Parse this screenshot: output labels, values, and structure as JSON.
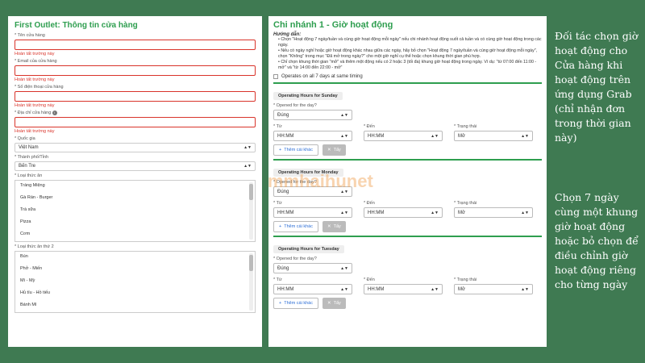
{
  "left": {
    "title": "First Outlet: Thông tin cửa hàng",
    "fields": [
      {
        "label": "* Tên cửa hàng",
        "error": "Hoàn tất trường này"
      },
      {
        "label": "* Email của cửa hàng",
        "error": "Hoàn tất trường này"
      },
      {
        "label": "* Số điện thoại cửa hàng",
        "error": "Hoàn tất trường này"
      },
      {
        "label": "* Địa chỉ cửa hàng",
        "error": "Hoàn tất trường này"
      }
    ],
    "country": {
      "label": "* Quốc gia",
      "value": "Việt Nam"
    },
    "city": {
      "label": "* Thành phố/Tỉnh",
      "value": "Bến Tre"
    },
    "food1": {
      "label": "* Loại thức ăn",
      "items": [
        "Tráng Miệng",
        "Gà Rán - Burger",
        "Trà sữa",
        "Pizza",
        "Cơm"
      ]
    },
    "food2": {
      "label": "* Loại thức ăn thứ 2",
      "items": [
        "Bún",
        "Phở - Miến",
        "Mì - Mỳ",
        "Hủ tíu - Hồ tiếu",
        "Bánh Mì"
      ]
    }
  },
  "right": {
    "title": "Chi nhánh 1 - Giờ hoạt động",
    "guide_heading": "Hướng dẫn:",
    "guide": [
      "Chọn \"Hoạt động 7 ngày/tuần và cùng giờ hoạt động mỗi ngày\" nếu chi nhánh hoạt động suốt cả tuần và có cùng giờ hoạt động trong các ngày.",
      "Nếu có ngày nghỉ hoặc giờ hoạt động khác nhau giữa các ngày, hãy bỏ chọn \"Hoạt động 7 ngày/tuần và cùng giờ hoạt động mỗi ngày\", chọn \"Không\" trong mục \"Đã mở trong ngày?\" cho một giờ nghỉ cụ thể hoặc chọn khung thời gian phù hợp.",
      "Chỉ chọn khung thời gian \"mở\" và thêm một động nếu có 2 hoặc 3 (tối đa) khung giờ hoạt động trong ngày. Ví dụ: \"từ 07:00 đến 11:00 - mở\" và \"từ 14:00 đến 22:00 - mở\""
    ],
    "checkbox_label": "Operates on all 7 days at same timing",
    "days": [
      {
        "header": "Operating Hours for Sunday"
      },
      {
        "header": "Operating Hours for Monday"
      },
      {
        "header": "Operating Hours for Tuesday"
      }
    ],
    "opened_label": "* Opened for the day?",
    "opened_value": "Đúng",
    "from_label": "* Từ",
    "to_label": "* Đến",
    "status_label": "* Trạng thái",
    "time_placeholder": "HH:MM",
    "status_value": "Mở",
    "add_label": "Thêm cái khác",
    "del_label": "Tẩy"
  },
  "watermark": "mmhaihunet",
  "caption": {
    "p1": "Đối tác chọn giờ hoạt động cho Cửa hàng khi hoạt động trên ứng dụng Grab (chỉ nhận đơn trong thời gian này)",
    "p2": "Chọn 7 ngày cùng một khung giờ hoạt động hoặc bỏ chọn để điều chỉnh giờ hoạt động riêng cho từng ngày"
  },
  "colors": {
    "background": "#3f7a52",
    "accent": "#2e9e4f",
    "error": "#d9342b"
  }
}
